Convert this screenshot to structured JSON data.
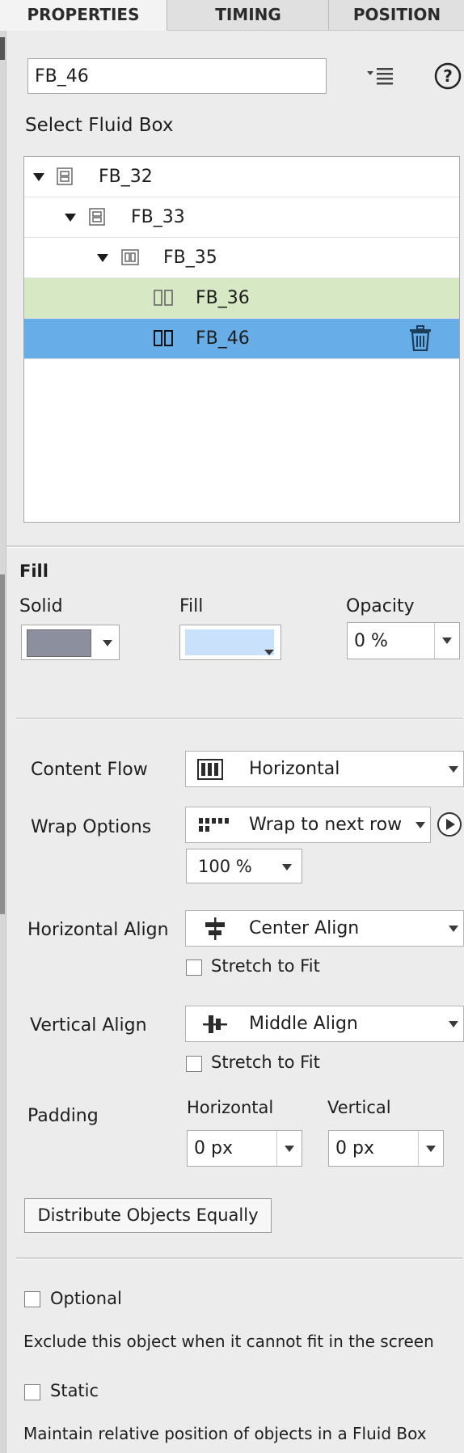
{
  "tabs": [
    {
      "label": "PROPERTIES",
      "active": true
    },
    {
      "label": "TIMING",
      "active": false
    },
    {
      "label": "POSITION",
      "active": false
    }
  ],
  "name_field": {
    "value": "FB_46",
    "menu_icon": "list-menu-icon",
    "help_icon": "help-icon"
  },
  "select_fluid_box": {
    "heading": "Select Fluid Box",
    "items": [
      {
        "label": "FB_32",
        "icon": "vertical-fluid-box-icon",
        "expanded": true,
        "state": "normal"
      },
      {
        "label": "FB_33",
        "icon": "vertical-fluid-box-icon",
        "expanded": true,
        "state": "normal"
      },
      {
        "label": "FB_35",
        "icon": "horizontal-fluid-box-icon",
        "expanded": true,
        "state": "normal"
      },
      {
        "label": "FB_36",
        "icon": "horizontal-fluid-box-icon",
        "expanded": false,
        "state": "highlighted"
      },
      {
        "label": "FB_46",
        "icon": "horizontal-fluid-box-icon",
        "expanded": false,
        "state": "selected",
        "action_icon": "trash-icon"
      }
    ]
  },
  "fill": {
    "heading": "Fill",
    "solid_label": "Solid",
    "fill_label": "Fill",
    "opacity_label": "Opacity",
    "solid_color": "#8c8f9d",
    "fill_color": "#c9e1fb",
    "opacity_value": "0 %"
  },
  "layout": {
    "content_flow_label": "Content Flow",
    "content_flow_value": "Horizontal",
    "wrap_options_label": "Wrap Options",
    "wrap_options_value": "Wrap to next row",
    "wrap_percent": "100 %",
    "horizontal_align_label": "Horizontal Align",
    "horizontal_align_value": "Center Align",
    "h_stretch_label": "Stretch to Fit",
    "vertical_align_label": "Vertical Align",
    "vertical_align_value": "Middle Align",
    "v_stretch_label": "Stretch to Fit",
    "padding_label": "Padding",
    "padding_horizontal_label": "Horizontal",
    "padding_vertical_label": "Vertical",
    "padding_horizontal_value": "0 px",
    "padding_vertical_value": "0 px",
    "distribute_button": "Distribute Objects Equally"
  },
  "options": {
    "optional_label": "Optional",
    "optional_desc": "Exclude this object when it cannot fit in the screen",
    "static_label": "Static",
    "static_desc": "Maintain relative position of objects in a Fluid Box"
  },
  "colors": {
    "selected_row": "#67aee9",
    "highlight_row": "#d6e8c4"
  }
}
